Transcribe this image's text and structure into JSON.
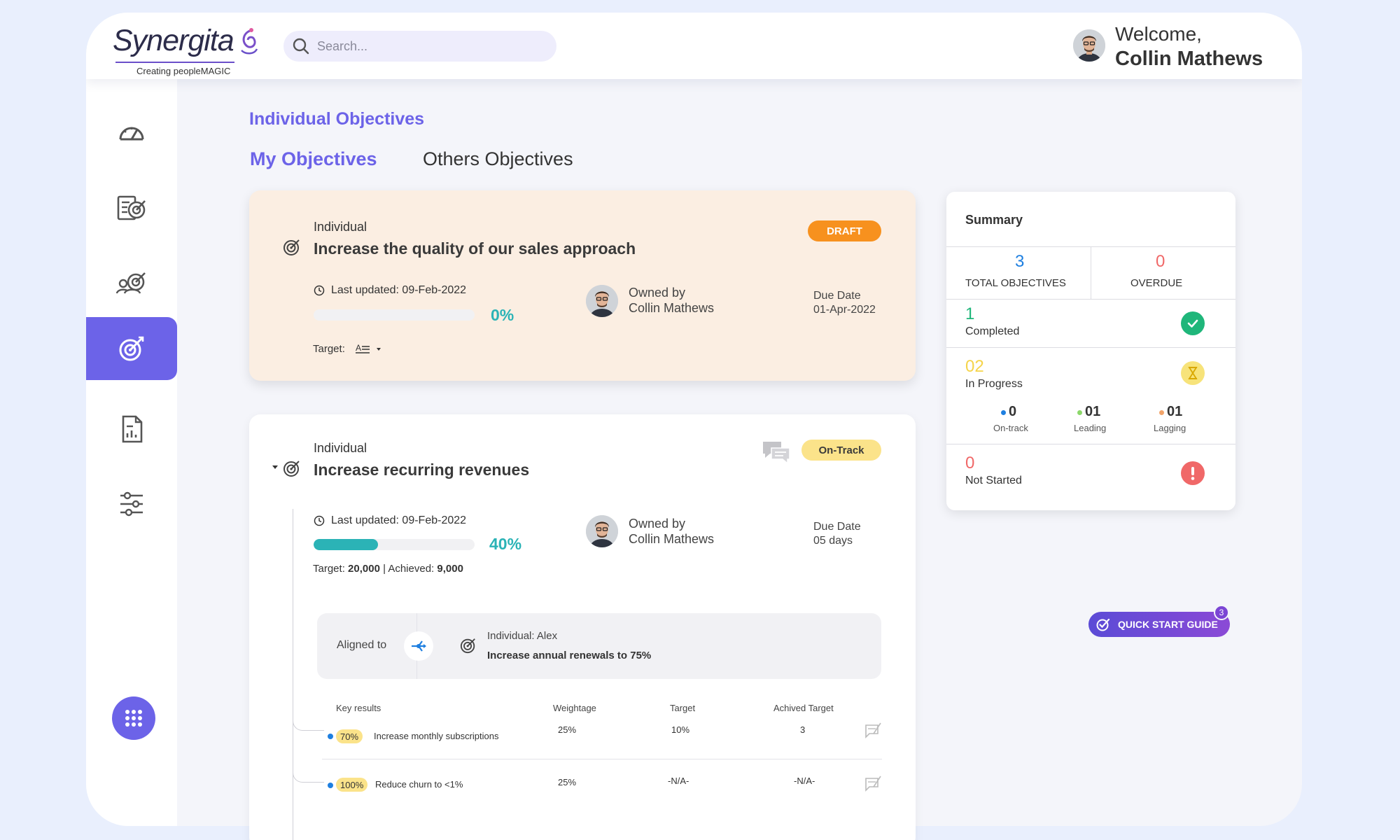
{
  "brand": {
    "name": "Synergita",
    "tagline": "Creating peopleMAGIC"
  },
  "search": {
    "placeholder": "Search..."
  },
  "user": {
    "greeting": "Welcome,",
    "name": "Collin Mathews"
  },
  "page": {
    "title": "Individual Objectives"
  },
  "tabs": {
    "my": "My Objectives",
    "others": "Others Objectives"
  },
  "objectives": [
    {
      "type": "Individual",
      "title": "Increase the quality of our sales approach",
      "status": "DRAFT",
      "last_updated": "Last updated: 09-Feb-2022",
      "progress": 0,
      "progress_label": "0%",
      "target_label": "Target:",
      "owner_label": "Owned by",
      "owner_name": "Collin Mathews",
      "due_label": "Due Date",
      "due_value": "01-Apr-2022"
    },
    {
      "type": "Individual",
      "title": "Increase recurring revenues",
      "status": "On-Track",
      "last_updated": "Last updated: 09-Feb-2022",
      "progress": 0.4,
      "progress_label": "40%",
      "target_prefix": "Target:",
      "target_value": "20,000",
      "achieved_prefix": "| Achieved:",
      "achieved_value": "9,000",
      "owner_label": "Owned by",
      "owner_name": "Collin Mathews",
      "due_label": "Due Date",
      "due_value": "05 days",
      "aligned": {
        "label": "Aligned to",
        "owner": "Individual: Alex",
        "title": "Increase annual renewals to 75%"
      },
      "key_results": {
        "headers": [
          "Key results",
          "Weightage",
          "Target",
          "Achived Target"
        ],
        "rows": [
          {
            "progress": "70%",
            "name": "Increase monthly subscriptions",
            "weightage": "25%",
            "target": "10%",
            "achieved": "3"
          },
          {
            "progress": "100%",
            "name": "Reduce churn to  <1%",
            "weightage": "25%",
            "target": "-N/A-",
            "achieved": "-N/A-"
          }
        ]
      }
    }
  ],
  "summary": {
    "title": "Summary",
    "total": {
      "value": "3",
      "label": "TOTAL OBJECTIVES"
    },
    "overdue": {
      "value": "0",
      "label": "OVERDUE"
    },
    "completed": {
      "value": "1",
      "label": "Completed"
    },
    "in_progress": {
      "value": "02",
      "label": "In Progress"
    },
    "on_track": {
      "value": "0",
      "label": "On-track"
    },
    "leading": {
      "value": "01",
      "label": "Leading"
    },
    "lagging": {
      "value": "01",
      "label": "Lagging"
    },
    "not_started": {
      "value": "0",
      "label": "Not Started"
    }
  },
  "quick_start": {
    "label": "QUICK START GUIDE",
    "count": "3"
  },
  "colors": {
    "accent": "#6c63e8",
    "teal": "#2bb3b6",
    "draft": "#f7911e",
    "ontrack": "#fbe38a",
    "completed": "#1fb67a",
    "in_progress": "#f5d44a",
    "not_started": "#f06868",
    "overdue": "#f06868",
    "total": "#1e7fe0"
  },
  "icons": {
    "nav": [
      "dashboard-icon",
      "goals-checklist-icon",
      "team-goals-icon",
      "objectives-target-icon",
      "reports-icon",
      "settings-sliders-icon"
    ],
    "apps": "apps-grid-icon"
  }
}
